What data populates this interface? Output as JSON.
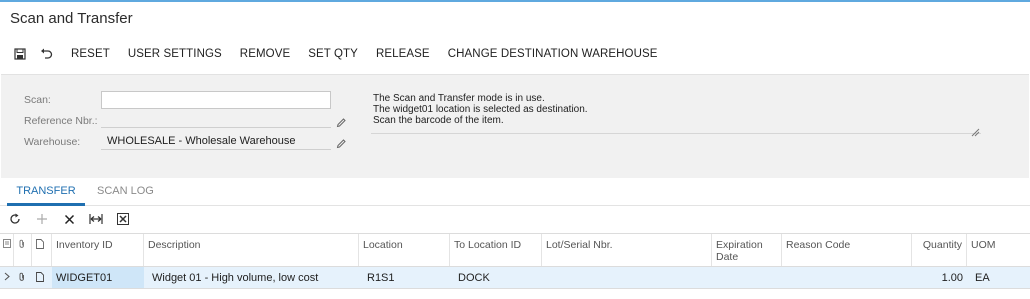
{
  "page": {
    "title": "Scan and Transfer"
  },
  "toolbar": {
    "icons": [
      "save-icon",
      "undo-icon"
    ],
    "buttons": [
      "RESET",
      "USER SETTINGS",
      "REMOVE",
      "SET QTY",
      "RELEASE",
      "CHANGE DESTINATION WAREHOUSE"
    ]
  },
  "form": {
    "scan_label": "Scan:",
    "scan_value": "",
    "ref_label": "Reference Nbr.:",
    "warehouse_label": "Warehouse:",
    "warehouse_value": "WHOLESALE - Wholesale Warehouse",
    "messages": [
      "The Scan and Transfer mode is in use.",
      "The widget01 location is selected as destination.",
      "Scan the barcode of the item."
    ]
  },
  "tabs": [
    {
      "label": "TRANSFER",
      "active": true
    },
    {
      "label": "SCAN LOG",
      "active": false
    }
  ],
  "grid_toolbar": {
    "icons": [
      "refresh-icon",
      "add-icon",
      "delete-icon",
      "fit-width-icon",
      "export-excel-icon"
    ]
  },
  "grid": {
    "columns": [
      "Inventory ID",
      "Description",
      "Location",
      "To Location ID",
      "Lot/Serial Nbr.",
      "Expiration Date",
      "Reason Code",
      "Quantity",
      "UOM"
    ],
    "rows": [
      {
        "inventory_id": "WIDGET01",
        "description": "Widget 01 - High volume, low cost",
        "location": "R1S1",
        "to_location": "DOCK",
        "lot_serial": "",
        "expiration": "",
        "reason": "",
        "quantity": "1.00",
        "uom": "EA"
      }
    ]
  },
  "colors": {
    "accent": "#1f6fb0",
    "selected_row": "#e6f2fc",
    "form_bg": "#f1f1f1"
  }
}
